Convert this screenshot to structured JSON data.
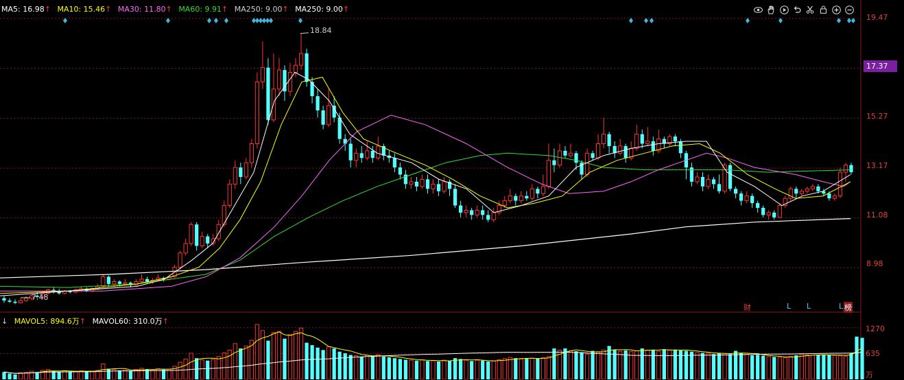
{
  "legend": {
    "ma5": "MA5: 16.98",
    "ma10": "MA10: 15.46",
    "ma30": "MA30: 11.80",
    "ma60": "MA60: 9.91",
    "ma250": "MA250: 9.00",
    "ma250b": "MA250: 9.00",
    "arrow": "↑"
  },
  "volume_legend": {
    "arrow_down": "↓",
    "mavol5": "MAVOL5: 894.6万",
    "mavol60": "MAVOL60: 310.0万",
    "arrow": "↑"
  },
  "price_axis": [
    "19.47",
    "17.37",
    "15.27",
    "13.17",
    "11.08",
    "8.98"
  ],
  "price_axis_highlight": "17.37",
  "volume_axis": [
    "1270",
    "635"
  ],
  "volume_unit": "万",
  "annotations": {
    "high": "18.84",
    "low": "7.48"
  },
  "markers": [
    {
      "label": "财",
      "color": "#e04040"
    },
    {
      "label": "L",
      "color": "#3fd0ff"
    },
    {
      "label": "L",
      "color": "#3fd0ff"
    },
    {
      "label": "L",
      "color": "#3fd0ff"
    },
    {
      "label": "榜",
      "color": "#ffffff"
    }
  ],
  "toolbar": [
    "eye-icon",
    "hand-icon",
    "play-icon",
    "undo-icon",
    "scissors-icon",
    "lock-icon",
    "zoom-in-icon",
    "zoom-out-icon"
  ],
  "colors": {
    "up": "#ff3333",
    "down": "#54ffff",
    "ma5": "#ffffff",
    "ma10": "#ffff00",
    "ma30": "#ff66ff",
    "ma60": "#33dd33",
    "ma250": "#ffffff",
    "grid": "#7a1c1c"
  },
  "chart_data": {
    "type": "candlestick",
    "price_range": [
      7.2,
      19.9
    ],
    "candles": [
      [
        7.7,
        7.6,
        7.8,
        7.5
      ],
      [
        7.6,
        7.55,
        7.7,
        7.5
      ],
      [
        7.55,
        7.5,
        7.65,
        7.45
      ],
      [
        7.5,
        7.6,
        7.7,
        7.48
      ],
      [
        7.6,
        7.7,
        7.8,
        7.55
      ],
      [
        7.7,
        7.8,
        7.9,
        7.6
      ],
      [
        7.8,
        7.75,
        7.95,
        7.7
      ],
      [
        7.75,
        7.9,
        8.0,
        7.7
      ],
      [
        7.9,
        8.05,
        8.1,
        7.85
      ],
      [
        8.05,
        8.0,
        8.15,
        7.9
      ],
      [
        8.0,
        7.9,
        8.1,
        7.85
      ],
      [
        7.9,
        8.0,
        8.05,
        7.85
      ],
      [
        8.0,
        7.95,
        8.05,
        7.9
      ],
      [
        7.95,
        8.05,
        8.1,
        7.9
      ],
      [
        8.05,
        8.1,
        8.2,
        8.0
      ],
      [
        8.1,
        8.0,
        8.15,
        7.95
      ],
      [
        8.0,
        8.1,
        8.15,
        7.95
      ],
      [
        8.1,
        8.2,
        8.3,
        8.05
      ],
      [
        8.2,
        8.6,
        8.7,
        8.15
      ],
      [
        8.6,
        8.3,
        8.65,
        8.2
      ],
      [
        8.3,
        8.4,
        8.5,
        8.2
      ],
      [
        8.4,
        8.3,
        8.45,
        8.2
      ],
      [
        8.3,
        8.35,
        8.5,
        8.25
      ],
      [
        8.35,
        8.25,
        8.4,
        8.15
      ],
      [
        8.25,
        8.4,
        8.5,
        8.2
      ],
      [
        8.4,
        8.5,
        8.7,
        8.35
      ],
      [
        8.5,
        8.4,
        8.6,
        8.3
      ],
      [
        8.4,
        8.45,
        8.55,
        8.3
      ],
      [
        8.45,
        8.55,
        8.7,
        8.4
      ],
      [
        8.55,
        8.5,
        8.6,
        8.4
      ],
      [
        8.5,
        8.6,
        8.7,
        8.45
      ],
      [
        8.6,
        9.0,
        9.1,
        8.55
      ],
      [
        9.0,
        9.6,
        9.7,
        8.9
      ],
      [
        9.6,
        10.0,
        10.2,
        9.5
      ],
      [
        10.0,
        10.8,
        10.9,
        9.9
      ],
      [
        10.8,
        9.9,
        10.9,
        9.7
      ],
      [
        9.9,
        10.3,
        10.5,
        9.8
      ],
      [
        10.3,
        10.0,
        10.4,
        9.8
      ],
      [
        10.0,
        10.2,
        10.4,
        9.9
      ],
      [
        10.2,
        10.8,
        11.0,
        10.1
      ],
      [
        10.8,
        11.6,
        11.8,
        10.7
      ],
      [
        11.6,
        12.5,
        12.7,
        11.5
      ],
      [
        12.5,
        13.2,
        13.5,
        12.3
      ],
      [
        13.2,
        12.8,
        13.4,
        12.5
      ],
      [
        12.8,
        13.4,
        13.6,
        12.7
      ],
      [
        13.4,
        14.2,
        14.4,
        13.2
      ],
      [
        14.2,
        16.8,
        17.2,
        14.0
      ],
      [
        16.8,
        17.4,
        18.5,
        16.5
      ],
      [
        17.4,
        15.2,
        17.8,
        15.0
      ],
      [
        15.2,
        16.5,
        18.0,
        15.1
      ],
      [
        16.5,
        17.3,
        17.8,
        16.2
      ],
      [
        17.3,
        16.4,
        17.5,
        16.0
      ],
      [
        16.4,
        17.2,
        17.6,
        16.2
      ],
      [
        17.2,
        17.5,
        17.8,
        17.0
      ],
      [
        17.5,
        18.0,
        18.84,
        17.3
      ],
      [
        18.0,
        16.8,
        18.2,
        16.6
      ],
      [
        16.8,
        16.2,
        17.0,
        15.9
      ],
      [
        16.2,
        15.6,
        16.5,
        15.3
      ],
      [
        15.6,
        15.0,
        15.8,
        14.8
      ],
      [
        15.0,
        15.8,
        16.5,
        14.9
      ],
      [
        15.8,
        15.3,
        16.2,
        15.1
      ],
      [
        15.3,
        14.4,
        15.5,
        14.2
      ],
      [
        14.4,
        14.2,
        14.6,
        13.9
      ],
      [
        14.2,
        13.5,
        14.4,
        13.2
      ],
      [
        13.5,
        13.8,
        14.0,
        13.2
      ],
      [
        13.8,
        13.6,
        14.1,
        13.4
      ],
      [
        13.6,
        13.9,
        14.3,
        13.5
      ],
      [
        13.9,
        13.6,
        14.1,
        13.4
      ],
      [
        13.6,
        14.1,
        14.5,
        13.5
      ],
      [
        14.1,
        13.7,
        14.2,
        13.5
      ],
      [
        13.7,
        13.6,
        13.9,
        13.4
      ],
      [
        13.6,
        13.2,
        13.8,
        13.0
      ],
      [
        13.2,
        12.9,
        13.4,
        12.7
      ],
      [
        12.9,
        12.5,
        13.1,
        12.3
      ],
      [
        12.5,
        12.6,
        12.8,
        12.3
      ],
      [
        12.6,
        12.4,
        12.8,
        12.2
      ],
      [
        12.4,
        12.7,
        12.9,
        12.3
      ],
      [
        12.7,
        12.3,
        12.9,
        12.1
      ],
      [
        12.3,
        12.5,
        12.7,
        12.1
      ],
      [
        12.5,
        12.2,
        12.7,
        12.0
      ],
      [
        12.2,
        12.6,
        12.8,
        12.1
      ],
      [
        12.6,
        12.3,
        12.7,
        12.0
      ],
      [
        12.3,
        11.6,
        12.5,
        11.5
      ],
      [
        11.6,
        11.3,
        11.8,
        11.1
      ],
      [
        11.3,
        11.4,
        11.6,
        11.1
      ],
      [
        11.4,
        11.2,
        11.5,
        11.0
      ],
      [
        11.2,
        11.4,
        11.6,
        11.1
      ],
      [
        11.4,
        11.2,
        11.6,
        11.0
      ],
      [
        11.2,
        11.0,
        11.4,
        10.9
      ],
      [
        11.0,
        11.3,
        11.5,
        10.9
      ],
      [
        11.3,
        11.6,
        11.8,
        11.2
      ],
      [
        11.6,
        11.8,
        12.0,
        11.5
      ],
      [
        11.8,
        12.0,
        12.3,
        11.7
      ],
      [
        12.0,
        11.8,
        12.1,
        11.6
      ],
      [
        11.8,
        12.0,
        12.2,
        11.7
      ],
      [
        12.0,
        11.9,
        12.2,
        11.8
      ],
      [
        11.9,
        12.3,
        12.5,
        11.8
      ],
      [
        12.3,
        12.1,
        12.4,
        11.9
      ],
      [
        12.1,
        12.4,
        12.9,
        12.0
      ],
      [
        12.4,
        13.5,
        14.2,
        12.3
      ],
      [
        13.5,
        13.3,
        14.0,
        13.0
      ],
      [
        13.3,
        13.9,
        14.2,
        13.2
      ],
      [
        13.9,
        13.7,
        14.1,
        13.6
      ],
      [
        13.7,
        13.8,
        14.2,
        13.6
      ],
      [
        13.8,
        13.4,
        13.9,
        13.1
      ],
      [
        13.4,
        12.9,
        13.5,
        12.7
      ],
      [
        12.9,
        13.8,
        14.0,
        12.8
      ],
      [
        13.8,
        13.6,
        13.9,
        13.5
      ],
      [
        13.6,
        14.2,
        14.6,
        13.5
      ],
      [
        14.2,
        14.6,
        15.3,
        14.0
      ],
      [
        14.6,
        14.1,
        14.7,
        13.8
      ],
      [
        14.1,
        13.8,
        14.3,
        13.6
      ],
      [
        13.8,
        14.1,
        14.4,
        13.7
      ],
      [
        14.1,
        13.6,
        14.2,
        13.4
      ],
      [
        13.6,
        14.0,
        14.3,
        13.5
      ],
      [
        14.0,
        14.6,
        15.0,
        13.9
      ],
      [
        14.6,
        14.2,
        14.8,
        14.0
      ],
      [
        14.2,
        14.3,
        14.9,
        14.1
      ],
      [
        14.3,
        13.9,
        14.5,
        13.7
      ],
      [
        13.9,
        14.4,
        14.8,
        13.8
      ],
      [
        14.4,
        14.2,
        14.5,
        14.0
      ],
      [
        14.2,
        14.5,
        14.6,
        14.1
      ],
      [
        14.5,
        14.3,
        14.6,
        14.1
      ],
      [
        14.3,
        13.8,
        14.4,
        13.6
      ],
      [
        13.8,
        13.2,
        13.9,
        12.7
      ],
      [
        13.2,
        12.6,
        13.4,
        12.4
      ],
      [
        12.6,
        12.8,
        13.0,
        12.5
      ],
      [
        12.8,
        12.4,
        13.0,
        12.2
      ],
      [
        12.4,
        12.7,
        12.9,
        12.3
      ],
      [
        12.7,
        12.5,
        12.8,
        12.3
      ],
      [
        12.5,
        12.2,
        12.9,
        12.1
      ],
      [
        12.2,
        13.3,
        13.4,
        12.1
      ],
      [
        13.3,
        12.3,
        13.4,
        12.2
      ],
      [
        12.3,
        12.1,
        12.4,
        11.9
      ],
      [
        12.1,
        11.8,
        12.2,
        11.6
      ],
      [
        11.8,
        12.0,
        12.2,
        11.7
      ],
      [
        12.0,
        11.7,
        12.1,
        11.5
      ],
      [
        11.7,
        11.5,
        11.8,
        11.3
      ],
      [
        11.5,
        11.2,
        11.6,
        11.1
      ],
      [
        11.2,
        11.3,
        11.4,
        11.0
      ],
      [
        11.3,
        11.1,
        11.4,
        11.0
      ],
      [
        11.1,
        11.6,
        11.7,
        11.1
      ],
      [
        11.6,
        11.9,
        12.0,
        11.5
      ],
      [
        11.9,
        12.3,
        12.4,
        11.8
      ],
      [
        12.3,
        12.1,
        12.4,
        11.9
      ],
      [
        12.1,
        12.2,
        12.3,
        12.0
      ],
      [
        12.2,
        12.3,
        12.4,
        12.1
      ],
      [
        12.3,
        12.4,
        12.5,
        12.2
      ],
      [
        12.4,
        12.2,
        12.5,
        12.1
      ],
      [
        12.2,
        12.1,
        12.3,
        12.0
      ],
      [
        12.1,
        11.9,
        12.2,
        11.8
      ],
      [
        11.9,
        12.0,
        12.1,
        11.8
      ],
      [
        12.0,
        13.0,
        13.2,
        11.9
      ],
      [
        13.0,
        13.3,
        13.4,
        12.6
      ],
      [
        13.3,
        13.0,
        13.4,
        12.9
      ]
    ],
    "ma250_points": [
      [
        0,
        8.55
      ],
      [
        160,
        8.7
      ],
      [
        300,
        8.9
      ],
      [
        440,
        9.2
      ],
      [
        600,
        9.5
      ],
      [
        760,
        9.9
      ],
      [
        920,
        10.4
      ],
      [
        1000,
        10.7
      ],
      [
        1100,
        10.9
      ],
      [
        1240,
        11.05
      ]
    ],
    "ma60_points": [
      [
        0,
        8.2
      ],
      [
        100,
        8.15
      ],
      [
        200,
        8.3
      ],
      [
        300,
        8.7
      ],
      [
        350,
        9.3
      ],
      [
        400,
        10.3
      ],
      [
        450,
        11.1
      ],
      [
        500,
        11.8
      ],
      [
        550,
        12.4
      ],
      [
        600,
        12.9
      ],
      [
        650,
        13.4
      ],
      [
        700,
        13.7
      ],
      [
        740,
        13.8
      ],
      [
        800,
        13.7
      ],
      [
        840,
        13.5
      ],
      [
        880,
        13.2
      ],
      [
        940,
        13.1
      ],
      [
        1000,
        13.1
      ],
      [
        1060,
        13.1
      ],
      [
        1120,
        13.0
      ],
      [
        1180,
        13.05
      ],
      [
        1240,
        13.1
      ]
    ],
    "ma30_points": [
      [
        0,
        8.0
      ],
      [
        150,
        8.0
      ],
      [
        250,
        8.2
      ],
      [
        300,
        8.6
      ],
      [
        350,
        9.4
      ],
      [
        400,
        10.7
      ],
      [
        440,
        12.0
      ],
      [
        480,
        13.5
      ],
      [
        520,
        14.7
      ],
      [
        570,
        15.4
      ],
      [
        620,
        15.0
      ],
      [
        680,
        14.2
      ],
      [
        740,
        13.2
      ],
      [
        790,
        12.5
      ],
      [
        830,
        12.1
      ],
      [
        880,
        12.2
      ],
      [
        920,
        12.6
      ],
      [
        960,
        13.1
      ],
      [
        1000,
        13.5
      ],
      [
        1030,
        13.8
      ],
      [
        1060,
        13.6
      ],
      [
        1100,
        13.2
      ],
      [
        1160,
        12.9
      ],
      [
        1200,
        12.6
      ],
      [
        1230,
        12.4
      ],
      [
        1240,
        12.6
      ]
    ],
    "ma10_points": [
      [
        0,
        7.9
      ],
      [
        100,
        8.0
      ],
      [
        200,
        8.3
      ],
      [
        250,
        8.6
      ],
      [
        290,
        9.0
      ],
      [
        320,
        9.8
      ],
      [
        350,
        11.0
      ],
      [
        380,
        12.6
      ],
      [
        410,
        15.0
      ],
      [
        440,
        16.8
      ],
      [
        470,
        17.0
      ],
      [
        500,
        15.5
      ],
      [
        530,
        14.4
      ],
      [
        570,
        13.9
      ],
      [
        620,
        13.3
      ],
      [
        660,
        12.7
      ],
      [
        700,
        12.0
      ],
      [
        740,
        11.5
      ],
      [
        780,
        11.7
      ],
      [
        820,
        12.0
      ],
      [
        860,
        13.0
      ],
      [
        900,
        13.5
      ],
      [
        940,
        13.8
      ],
      [
        980,
        14.1
      ],
      [
        1020,
        14.2
      ],
      [
        1050,
        13.8
      ],
      [
        1090,
        12.9
      ],
      [
        1130,
        12.3
      ],
      [
        1160,
        11.9
      ],
      [
        1200,
        12.0
      ],
      [
        1240,
        12.6
      ]
    ],
    "ma5_points": [
      [
        0,
        7.8
      ],
      [
        100,
        8.0
      ],
      [
        200,
        8.2
      ],
      [
        240,
        8.5
      ],
      [
        280,
        9.3
      ],
      [
        310,
        10.0
      ],
      [
        340,
        11.5
      ],
      [
        370,
        13.0
      ],
      [
        400,
        16.0
      ],
      [
        430,
        17.2
      ],
      [
        450,
        16.9
      ],
      [
        480,
        16.0
      ],
      [
        510,
        14.6
      ],
      [
        550,
        13.8
      ],
      [
        600,
        13.4
      ],
      [
        640,
        12.7
      ],
      [
        680,
        12.3
      ],
      [
        720,
        11.3
      ],
      [
        760,
        11.6
      ],
      [
        800,
        12.0
      ],
      [
        840,
        13.2
      ],
      [
        880,
        13.7
      ],
      [
        920,
        14.0
      ],
      [
        960,
        14.2
      ],
      [
        1000,
        14.3
      ],
      [
        1030,
        14.3
      ],
      [
        1060,
        13.0
      ],
      [
        1100,
        12.4
      ],
      [
        1140,
        11.6
      ],
      [
        1170,
        12.0
      ],
      [
        1200,
        12.2
      ],
      [
        1240,
        12.9
      ]
    ],
    "volumes": [
      180,
      140,
      120,
      160,
      170,
      200,
      180,
      220,
      240,
      200,
      180,
      210,
      190,
      200,
      210,
      190,
      200,
      220,
      380,
      260,
      240,
      220,
      230,
      210,
      240,
      270,
      250,
      240,
      260,
      240,
      250,
      320,
      420,
      500,
      640,
      520,
      480,
      460,
      490,
      560,
      650,
      720,
      880,
      760,
      820,
      960,
      1350,
      1200,
      950,
      1150,
      1180,
      1000,
      1100,
      1180,
      1260,
      900,
      840,
      780,
      720,
      800,
      760,
      680,
      640,
      600,
      580,
      560,
      590,
      560,
      610,
      560,
      540,
      520,
      500,
      480,
      470,
      460,
      480,
      450,
      460,
      440,
      470,
      450,
      520,
      500,
      470,
      450,
      470,
      460,
      440,
      450,
      480,
      510,
      540,
      520,
      500,
      510,
      520,
      510,
      530,
      560,
      760,
      720,
      760,
      700,
      690,
      660,
      620,
      700,
      680,
      720,
      820,
      720,
      690,
      710,
      680,
      700,
      760,
      720,
      730,
      690,
      740,
      720,
      730,
      710,
      700,
      680,
      660,
      650,
      640,
      620,
      640,
      630,
      620,
      700,
      650,
      610,
      590,
      600,
      580,
      560,
      550,
      540,
      530,
      560,
      590,
      620,
      600,
      590,
      600,
      610,
      600,
      590,
      580,
      570,
      650,
      1050,
      1020
    ]
  }
}
